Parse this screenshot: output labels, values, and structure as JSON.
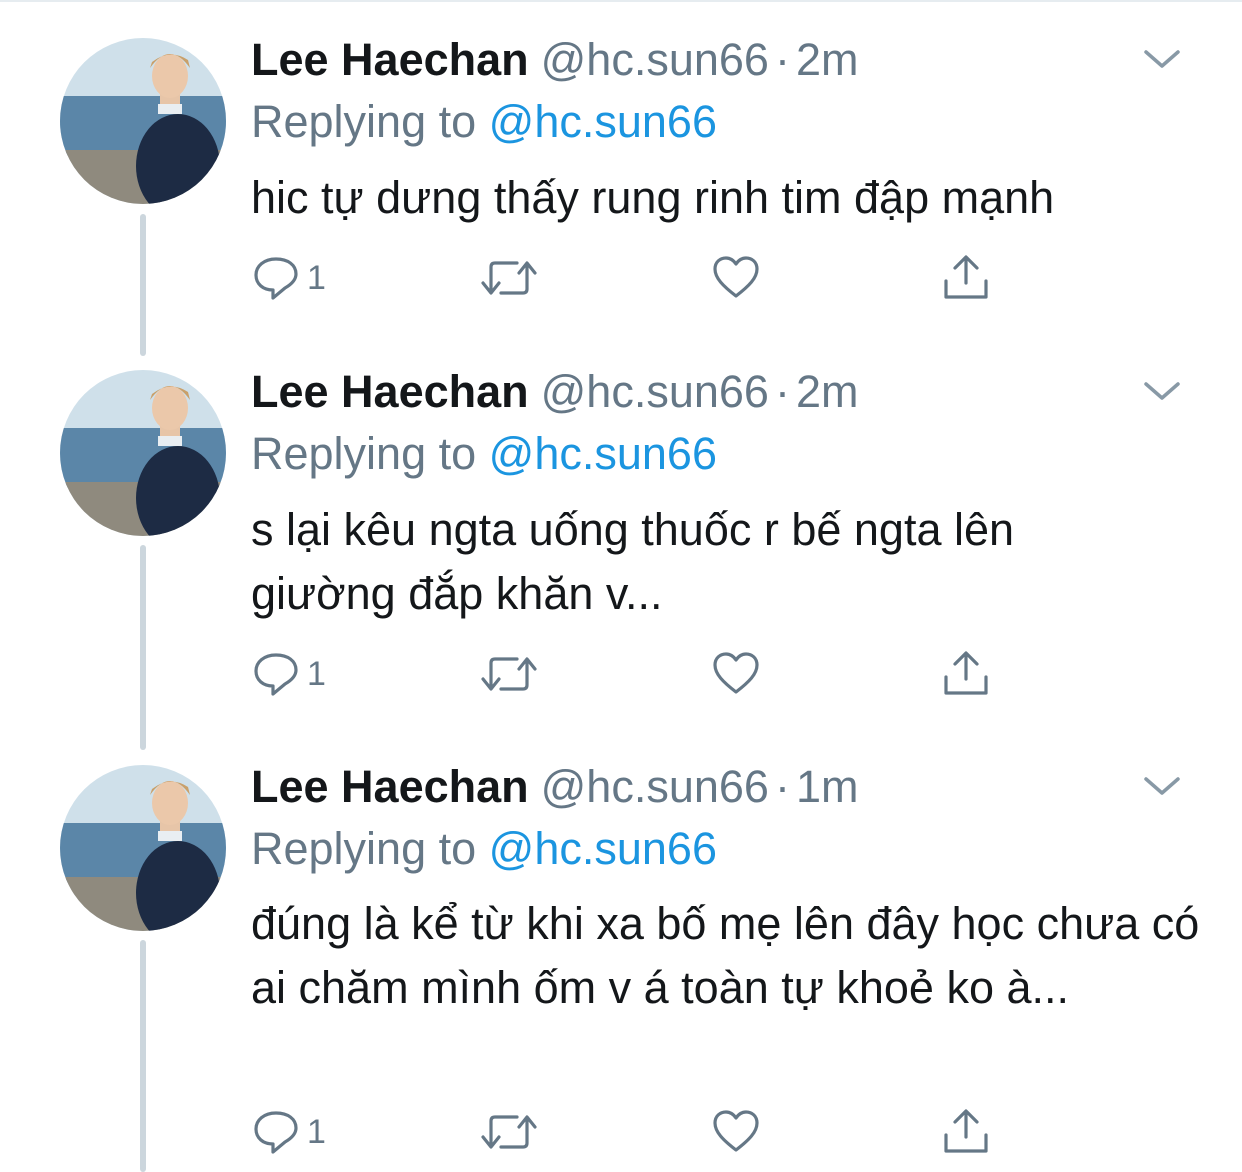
{
  "tweets": [
    {
      "name": "Lee Haechan",
      "handle": "@hc.sun66",
      "separator": "·",
      "time": "2m",
      "replying_prefix": "Replying to",
      "replying_to": "@hc.sun66",
      "text": "hic tự dưng thấy rung rinh tim đập mạnh",
      "reply_count": "1"
    },
    {
      "name": "Lee Haechan",
      "handle": "@hc.sun66",
      "separator": "·",
      "time": "2m",
      "replying_prefix": "Replying to",
      "replying_to": "@hc.sun66",
      "text": "s lại kêu ngta uống thuốc r bế ngta lên giường đắp khăn v...",
      "reply_count": "1"
    },
    {
      "name": "Lee Haechan",
      "handle": "@hc.sun66",
      "separator": "·",
      "time": "1m",
      "replying_prefix": "Replying to",
      "replying_to": "@hc.sun66",
      "text": "đúng là kể từ khi xa bố mẹ lên đây học chưa có ai chăm mình ốm v á toàn tự khoẻ ko à...",
      "reply_count": "1"
    }
  ],
  "icons": {
    "reply": "reply-icon",
    "retweet": "retweet-icon",
    "like": "heart-icon",
    "share": "share-icon",
    "caret": "chevron-down-icon"
  },
  "colors": {
    "text": "#14171a",
    "secondary": "#657786",
    "link": "#1b95e0",
    "thread_line": "#ccd6dd"
  }
}
